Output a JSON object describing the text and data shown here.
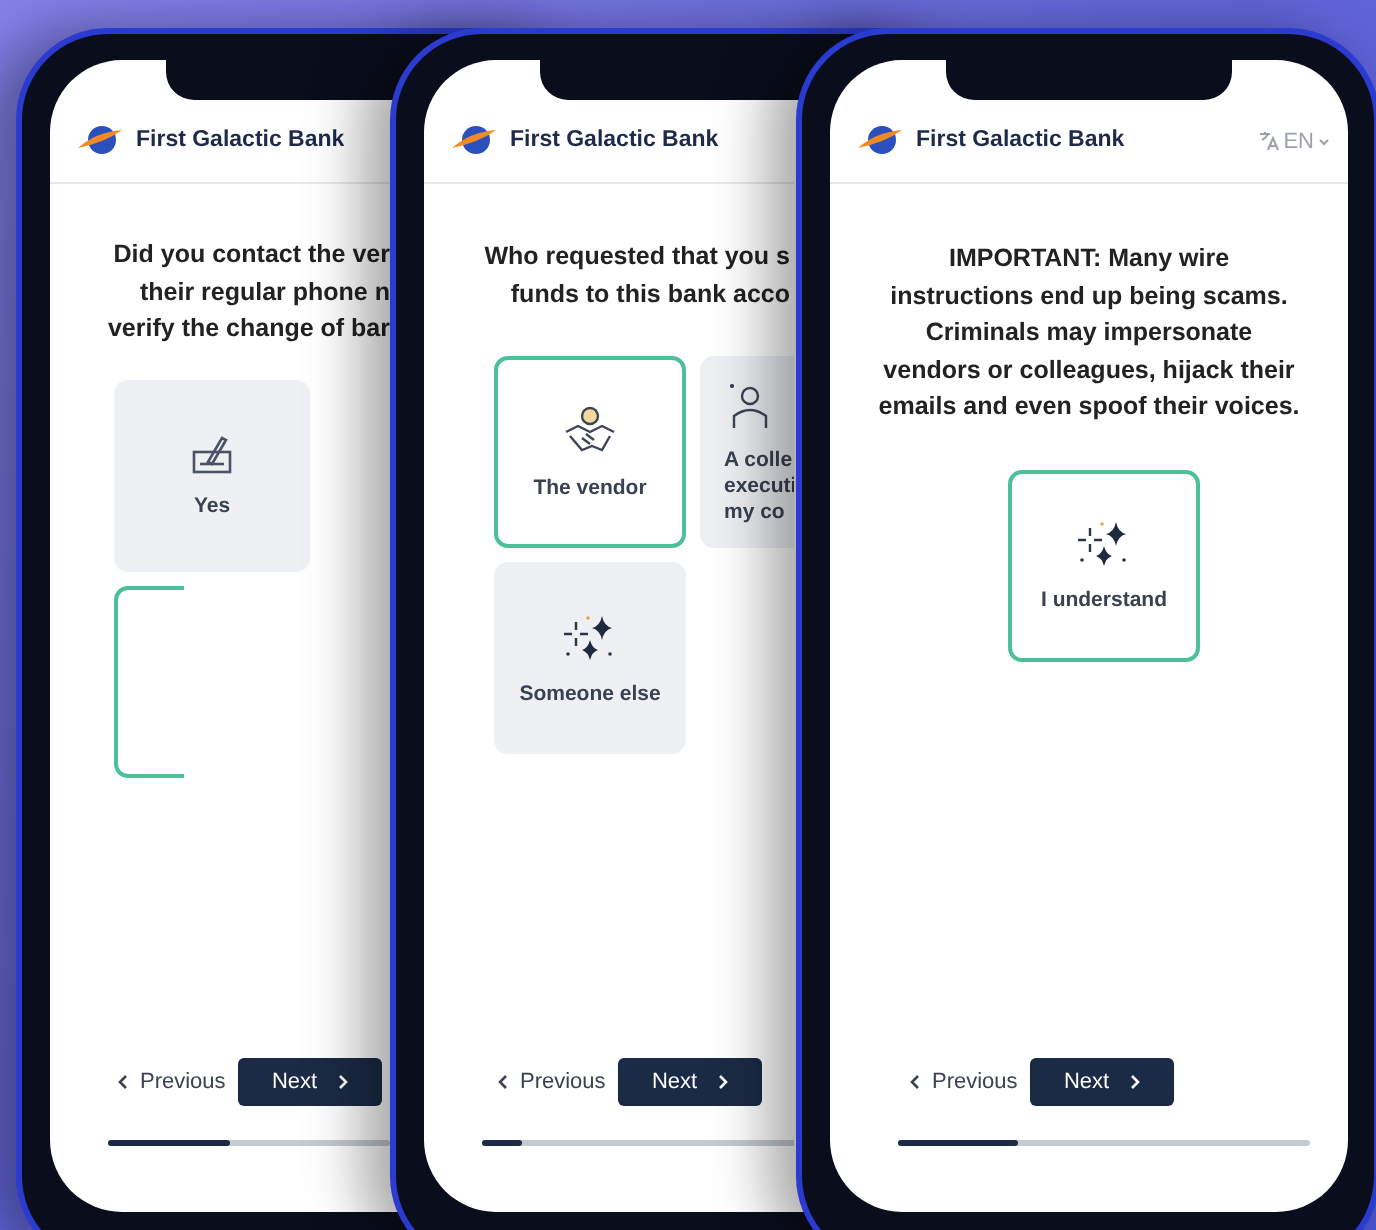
{
  "phones": [
    {
      "brand": "First Galactic Bank",
      "question_lines": [
        "Did you contact the ver",
        "their regular phone n",
        "verify the change of bar"
      ],
      "options": [
        {
          "kind": "yes",
          "lines": [
            "Yes"
          ],
          "selected": false
        },
        {
          "selected": true
        }
      ],
      "nav": {
        "previous": "Previous",
        "next": "Next"
      },
      "progress": {
        "level": 0.43
      }
    },
    {
      "brand": "First Galactic Bank",
      "question_lines": [
        "Who requested that you s",
        "funds to this bank acco"
      ],
      "options": [
        {
          "kind": "vendor",
          "lines": [
            "The vendor"
          ],
          "selected": true
        },
        {
          "kind": "colleague",
          "lines": [
            "A colle",
            "executi",
            "my co"
          ],
          "selected": false
        },
        {
          "kind": "other",
          "lines": [
            "Someone else"
          ],
          "selected": false
        }
      ],
      "nav": {
        "previous": "Previous",
        "next": "Next"
      },
      "progress": {
        "level": 0.13
      }
    },
    {
      "brand": "First Galactic Bank",
      "language": "EN",
      "question_lines": [
        "IMPORTANT: Many wire",
        "instructions end up being scams.",
        "Criminals may impersonate",
        "vendors or colleagues, hijack their",
        "emails and even spoof their voices."
      ],
      "options": [
        {
          "kind": "acknowledge",
          "lines": [
            "I understand"
          ],
          "selected": true
        }
      ],
      "nav": {
        "previous": "Previous",
        "next": "Next"
      },
      "progress": {
        "level": 0.29
      }
    }
  ]
}
